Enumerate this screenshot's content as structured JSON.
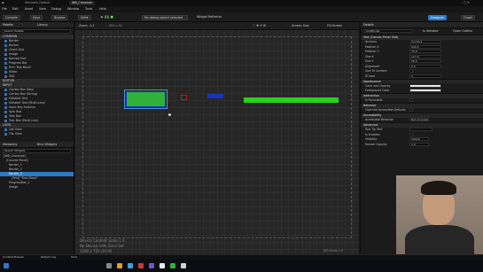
{
  "titlebar": {
    "title": "Unreal Editor",
    "project": "Wsnewio Default",
    "tab": "WB_Crosshair"
  },
  "menu": [
    "File",
    "Edit",
    "Asset",
    "View",
    "Debug",
    "Window",
    "Tools",
    "Help"
  ],
  "toolbar": {
    "compile": "Compile",
    "save": "Save",
    "browse": "Browse",
    "mode": "Def★",
    "debug_select": "No debug object selected",
    "widget_reflector": "Widget Reflector",
    "designer": "Designer",
    "graph": "Graph"
  },
  "palette": {
    "title": "Palette",
    "library": "Library",
    "search_placeholder": "Search Palette",
    "sections": [
      {
        "name": "COMMON",
        "items": [
          "Border",
          "Button",
          "Check Box",
          "Image",
          "Named Slot",
          "Progress Bar",
          "Rich Text Block",
          "Slider",
          "Text"
        ]
      },
      {
        "name": "EDITOR",
        "items": []
      },
      {
        "name": "INPUT",
        "items": [
          "Combo Box (Key)",
          "Combo Box (String)",
          "Editable Text",
          "Editable Text (Multi-Line)",
          "Input Key Selector",
          "Spin Box",
          "Text Box",
          "Text Box (Multi-Line)"
        ]
      },
      {
        "name": "LISTS",
        "items": [
          "List View",
          "Tile View"
        ]
      }
    ]
  },
  "hierarchy": {
    "title": "Hierarchy",
    "bind": "Bind Widgets",
    "search_placeholder": "Search Widgets",
    "items": [
      "[WB_Crosshair]",
      "[Canvas Panel]",
      "Border_1",
      "Border_2",
      "Border_3",
      "[Text] \"Text Block\"",
      "ProgressBar_1",
      "Image"
    ]
  },
  "viewport": {
    "zoom": "Zoom -1:1",
    "res": "800 x 92",
    "screen_size": "Screen Size",
    "fill_screen": "Fill Screen",
    "dpi": "DPI Scale 1.0",
    "device_info": [
      "Device Content Scale 1.0",
      "No Device Safe Zone Set",
      "1280 x 720 (16:9)"
    ]
  },
  "details": {
    "title": "Details",
    "widget_name": "ImgBorder",
    "variable": "Is Variable",
    "options": "Open Outline",
    "sections": [
      {
        "name": "Slot (Canvas Panel Slot)",
        "rows": [
          [
            "Anchors",
            "Anchors"
          ],
          [
            "Position X",
            "640.0"
          ],
          [
            "Position Y",
            "70.0"
          ],
          [
            "Size X",
            "127.0"
          ],
          [
            "Size Y",
            "56.0"
          ],
          [
            "Alignment",
            "0.0"
          ],
          [
            "Size To Content",
            ""
          ],
          [
            "ZOrder",
            "0"
          ]
        ]
      },
      {
        "name": "Appearance",
        "rows": [
          [
            "Color and Opacity",
            ""
          ],
          [
            "Foreground Color",
            ""
          ]
        ]
      },
      {
        "name": "Interaction",
        "rows": [
          [
            "Is Focusable",
            ""
          ]
        ]
      },
      {
        "name": "Behavior",
        "rows": [
          [
            "Override Accessible Defaults",
            ""
          ]
        ]
      },
      {
        "name": "Accessibility",
        "rows": [
          [
            "Accessible Behavior",
            "Not Accessible"
          ]
        ]
      },
      {
        "name": "Advanced",
        "rows": [
          [
            "Tool Tip Text",
            ""
          ],
          [
            "Is Enabled",
            ""
          ],
          [
            "Visibility",
            "Visible"
          ],
          [
            "Render Opacity",
            "1.0"
          ]
        ]
      }
    ]
  },
  "status": {
    "content_drawer": "Content Drawer",
    "output_log": "Output Log",
    "cmd": "Cmd"
  },
  "colors": {
    "green_bar": "#27d21b",
    "blue_box": "#1932c4",
    "red_box": "#c3141a",
    "selected_box": "#2fb13a",
    "accent": "#2a7ac7"
  },
  "webcam": {
    "present": true
  }
}
